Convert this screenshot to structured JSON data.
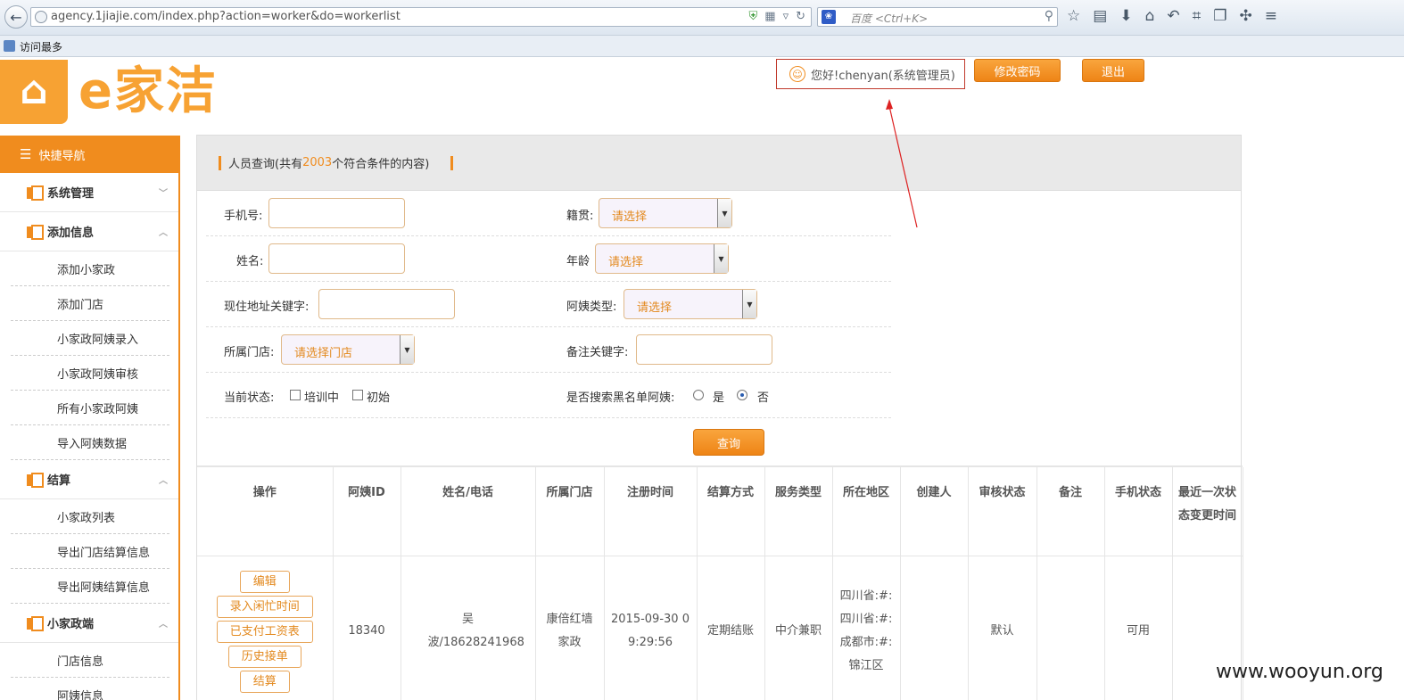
{
  "browser": {
    "url": "agency.1jiajie.com/index.php?action=worker&do=workerlist",
    "search_placeholder": "百度 <Ctrl+K>",
    "bookmark_label": "访问最多"
  },
  "header": {
    "logo_mark": "⌂",
    "logo_text": "e家洁",
    "greeting": "您好!chenyan(系统管理员)",
    "change_password": "修改密码",
    "logout": "退出"
  },
  "sidebar": {
    "title": "快捷导航",
    "groups": [
      {
        "label": "系统管理",
        "items": []
      },
      {
        "label": "添加信息",
        "items": [
          "添加小家政",
          "添加门店",
          "小家政阿姨录入",
          "小家政阿姨审核",
          "所有小家政阿姨",
          "导入阿姨数据"
        ]
      },
      {
        "label": "结算",
        "items": [
          "小家政列表",
          "导出门店结算信息",
          "导出阿姨结算信息"
        ]
      },
      {
        "label": "小家政端",
        "items": [
          "门店信息",
          "阿姨信息"
        ]
      }
    ]
  },
  "panel": {
    "title": "人员查询",
    "count_prefix": "(共有",
    "count": "2003",
    "count_suffix": "个符合条件的内容)"
  },
  "form": {
    "phone_label": "手机号:",
    "name_label": "姓名:",
    "address_label": "现住地址关键字:",
    "store_label": "所属门店:",
    "store_placeholder": "请选择门店",
    "status_label": "当前状态:",
    "status_opt1": "培训中",
    "status_opt2": "初始",
    "origin_label": "籍贯:",
    "age_label": "年龄",
    "type_label": "阿姨类型:",
    "select_placeholder": "请选择",
    "remark_label": "备注关键字:",
    "blacklist_label": "是否搜索黑名单阿姨:",
    "yes": "是",
    "no": "否",
    "query_button": "查询"
  },
  "table": {
    "headers": [
      "操作",
      "阿姨ID",
      "姓名/电话",
      "所属门店",
      "注册时间",
      "结算方式",
      "服务类型",
      "所在地区",
      "创建人",
      "审核状态",
      "备注",
      "手机状态",
      "最近一次状态变更时间"
    ],
    "actions": [
      "编辑",
      "录入闲忙时间",
      "已支付工资表",
      "历史接单",
      "结算"
    ],
    "row": {
      "id": "18340",
      "name_phone": "吴波/18628241968",
      "store": "康倍红墙家政",
      "reg_time": "2015-09-30 09:29:56",
      "settlement": "定期结账",
      "service_type": "中介兼职",
      "region": "四川省:#:四川省:#:成都市:#:锦江区",
      "creator": "",
      "audit": "默认",
      "remark": "",
      "phone_status": "可用",
      "last_change": ""
    }
  },
  "watermark": "www.wooyun.org",
  "colors": {
    "accent": "#f08c1e",
    "highlight_box": "#c0392b"
  }
}
